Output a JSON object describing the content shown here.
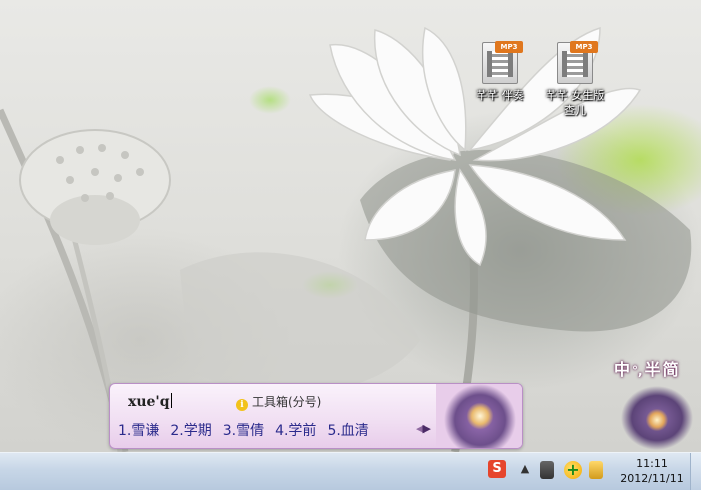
{
  "desktop": {
    "icons": [
      {
        "name": "mp3-accompaniment",
        "badge": "MP3",
        "label": "芊芊 伴奏"
      },
      {
        "name": "mp3-female-version",
        "badge": "MP3",
        "label": "芊芊 女生版 查儿"
      }
    ]
  },
  "ime": {
    "composition": "xue'q",
    "toolbox_label": "工具箱(分号)",
    "candidates": [
      "1.雪谦",
      "2.学期",
      "3.雪倩",
      "4.学前",
      "5.血清"
    ],
    "prev_arrow": "◀",
    "next_arrow": "▶"
  },
  "ime_status": {
    "mode": "中",
    "punct": "°,",
    "width": "半",
    "charset": "简"
  },
  "taskbar": {
    "tray": {
      "sogou_icon_text": "S",
      "show_hidden": "▲",
      "security_icon_text": "+"
    },
    "clock": {
      "time": "11:11",
      "date": "2012/11/11"
    }
  },
  "colors": {
    "ime_border": "#b98fc6",
    "candidate_text": "#2b2b8c",
    "taskbar": "#c7d6e7",
    "mp3_badge": "#e0771e"
  }
}
